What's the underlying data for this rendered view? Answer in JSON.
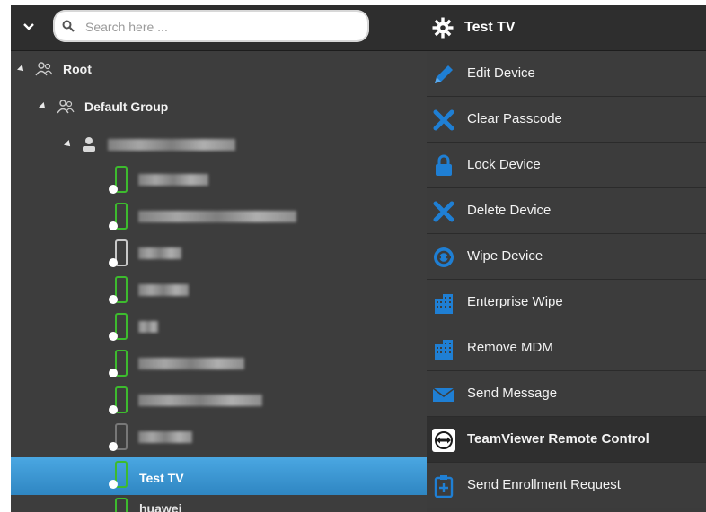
{
  "search": {
    "placeholder": "Search here ..."
  },
  "tree": {
    "root_label": "Root",
    "group_label": "Default Group",
    "selected_label": "Test TV",
    "partial_label": "huawei"
  },
  "panel": {
    "title": "Test TV",
    "actions": [
      {
        "label": "Edit Device",
        "icon": "pencil-icon"
      },
      {
        "label": "Clear Passcode",
        "icon": "x-icon"
      },
      {
        "label": "Lock Device",
        "icon": "lock-icon"
      },
      {
        "label": "Delete Device",
        "icon": "x-icon"
      },
      {
        "label": "Wipe Device",
        "icon": "wipe-icon"
      },
      {
        "label": "Enterprise Wipe",
        "icon": "building-icon"
      },
      {
        "label": "Remove MDM",
        "icon": "building-icon"
      },
      {
        "label": "Send Message",
        "icon": "envelope-icon"
      },
      {
        "label": "TeamViewer Remote Control",
        "icon": "teamviewer-icon"
      },
      {
        "label": "Send Enrollment Request",
        "icon": "enrollment-icon"
      }
    ]
  },
  "colors": {
    "accent_blue": "#1f7fd4",
    "selected_row": "#3e9ad6",
    "android_green": "#3dbb2e"
  }
}
